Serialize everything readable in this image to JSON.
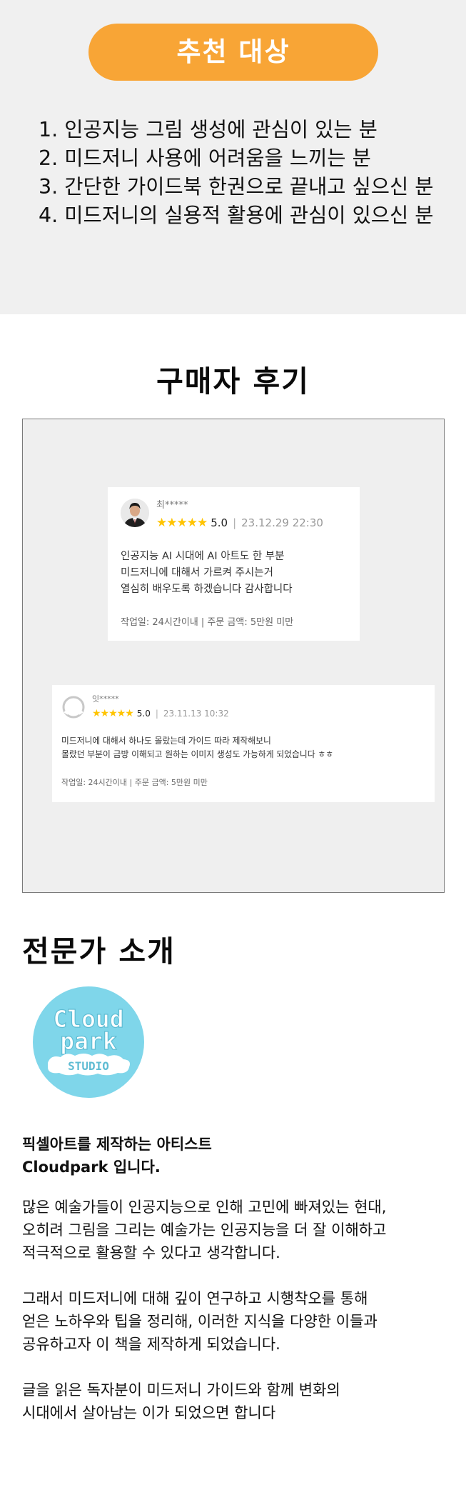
{
  "recommend": {
    "title": "추천 대상",
    "items": [
      "1. 인공지능 그림 생성에 관심이 있는 분",
      "2. 미드저니 사용에 어려움을 느끼는 분",
      "3. 간단한 가이드북 한권으로 끝내고 싶으신 분",
      "4. 미드저니의 실용적 활용에 관심이 있으신 분"
    ]
  },
  "reviews": {
    "heading": "구매자 후기",
    "items": [
      {
        "name": "최*****",
        "stars": "★★★★★",
        "score": "5.0",
        "separator": "|",
        "date": "23.12.29 22:30",
        "lines": [
          "인공지능 AI 시대에  AI 아트도 한 부분",
          "미드저니에  대해서 가르켜 주시는거",
          "열심히 배우도록 하겠습니다  감사합니다"
        ],
        "meta": "작업일: 24시간이내 | 주문 금액: 5만원 미만"
      },
      {
        "name": "잇*****",
        "stars": "★★★★★",
        "score": "5.0",
        "separator": "|",
        "date": "23.11.13 10:32",
        "lines": [
          "미드저니에 대해서 하나도 몰랐는데 가이드 따라 제작해보니",
          "몰랐던 부분이 금방 이해되고 원하는 이미지 생성도 가능하게 되었습니다 ㅎㅎ"
        ],
        "meta": "작업일: 24시간이내 | 주문 금액: 5만원 미만"
      }
    ]
  },
  "expert": {
    "heading": "전문가 소개",
    "logo": {
      "line1": "Cloud",
      "line2": "park",
      "line3": "STUDIO",
      "bg_color": "#7fd6ea"
    },
    "intro_lines": [
      "픽셀아트를 제작하는 아티스트",
      "Cloudpark 입니다."
    ],
    "paragraphs": [
      [
        "많은 예술가들이 인공지능으로 인해 고민에 빠져있는 현대,",
        "오히려 그림을 그리는 예술가는 인공지능을 더 잘 이해하고",
        "적극적으로 활용할 수 있다고 생각합니다."
      ],
      [
        "그래서 미드저니에 대해 깊이 연구하고 시행착오를 통해",
        "얻은 노하우와 팁을 정리해, 이러한 지식을 다양한 이들과",
        "공유하고자 이 책을 제작하게 되었습니다."
      ],
      [
        "글을 읽은 독자분이 미드저니 가이드와 함께 변화의",
        "시대에서 살아남는 이가 되었으면 합니다"
      ]
    ]
  },
  "colors": {
    "accent": "#f8a536",
    "section_bg": "#f0f0f0",
    "star": "#ffc400"
  }
}
